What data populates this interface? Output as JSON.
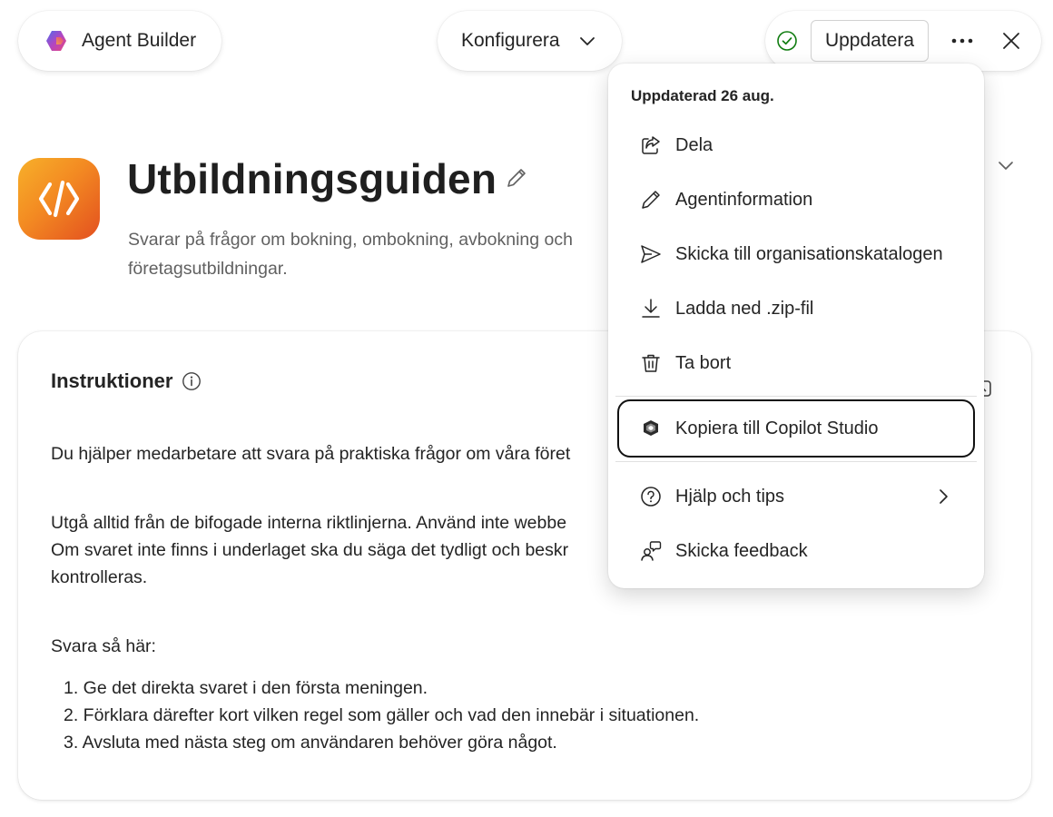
{
  "app": {
    "name": "Agent Builder"
  },
  "toolbar": {
    "mode_label": "Konfigurera",
    "update_label": "Uppdatera"
  },
  "agent": {
    "title": "Utbildningsguiden",
    "description_line1": "Svarar på frågor om bokning, ombokning, avbokning och",
    "description_line2": "företagsutbildningar."
  },
  "instructions": {
    "heading": "Instruktioner",
    "paragraph1": "Du hjälper medarbetare att svara på praktiska frågor om våra föret",
    "paragraph2_line1": "Utgå alltid från de bifogade interna riktlinjerna. Använd inte webbe",
    "paragraph2_line2": "Om svaret inte finns i underlaget ska du säga det tydligt och beskr",
    "paragraph2_line3": "kontrolleras.",
    "paragraph3": "Svara så här:",
    "steps": [
      "1. Ge det direkta svaret i den första meningen.",
      "2. Förklara därefter kort vilken regel som gäller och vad den innebär i situationen.",
      "3. Avsluta med nästa steg om användaren behöver göra något."
    ]
  },
  "menu": {
    "header": "Uppdaterad 26 aug.",
    "items": [
      {
        "label": "Dela",
        "icon": "share-icon"
      },
      {
        "label": "Agentinformation",
        "icon": "pencil-icon"
      },
      {
        "label": "Skicka till organisationskatalogen",
        "icon": "send-icon"
      },
      {
        "label": "Ladda ned .zip-fil",
        "icon": "download-icon"
      },
      {
        "label": "Ta bort",
        "icon": "trash-icon"
      },
      {
        "label": "Kopiera till Copilot Studio",
        "icon": "copilot-studio-icon"
      },
      {
        "label": "Hjälp och tips",
        "icon": "help-icon"
      },
      {
        "label": "Skicka feedback",
        "icon": "feedback-icon"
      }
    ]
  },
  "colors": {
    "agent_icon_gradient": [
      "#f7b02a",
      "#f38a22",
      "#e3501f"
    ],
    "status_check": "#107c10"
  }
}
